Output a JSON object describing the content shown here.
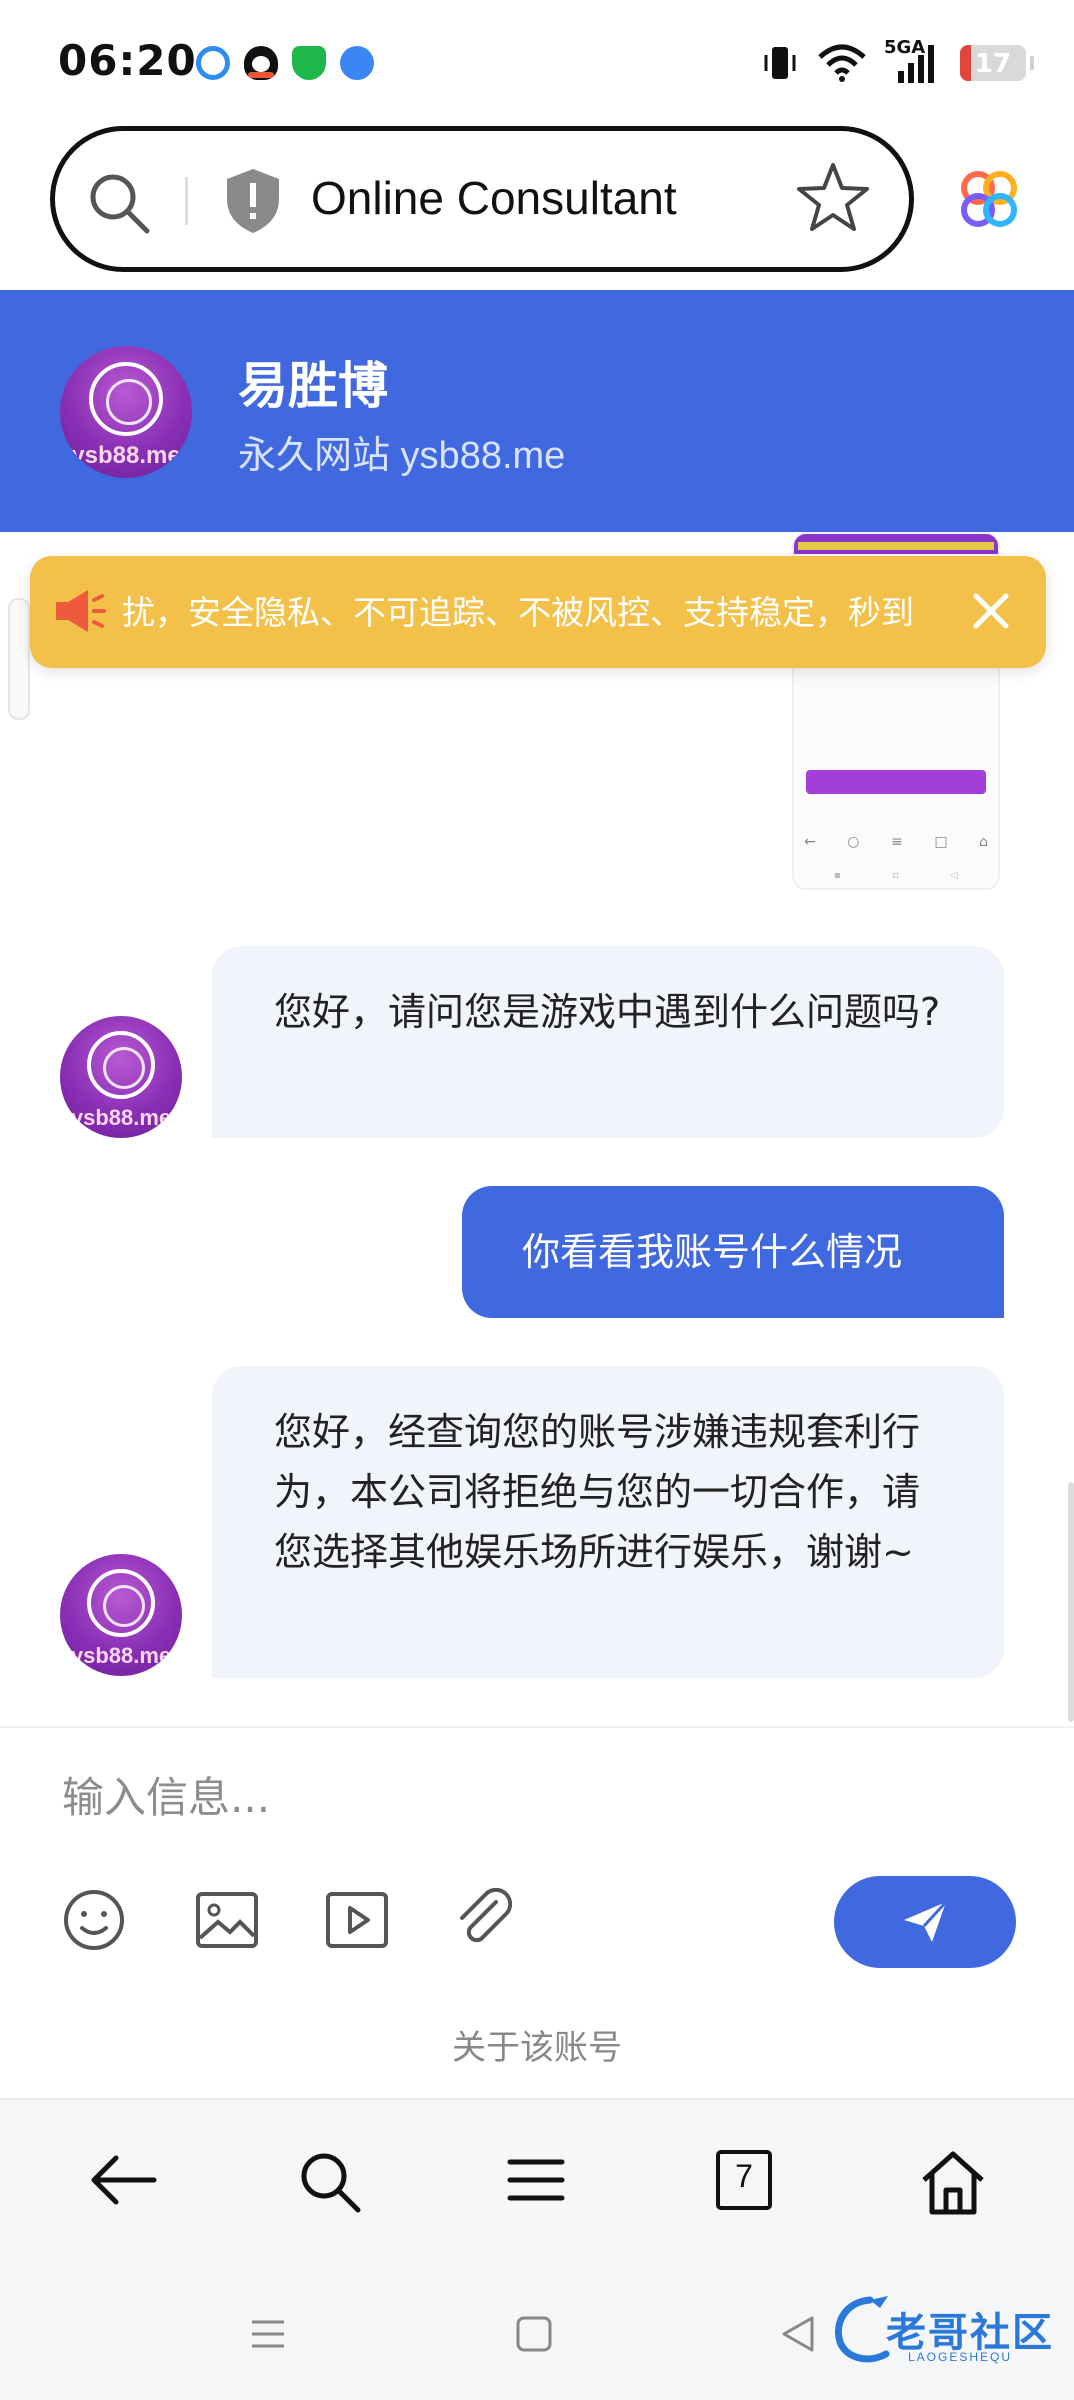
{
  "status_bar": {
    "time": "06:20",
    "network": "5GA",
    "battery": "17",
    "battery_level_percent": 17,
    "notification_icons": [
      "message-app-icon",
      "qq-penguin-icon",
      "security-shield-icon",
      "browser-app-icon"
    ]
  },
  "browser": {
    "address_title": "Online Consultant",
    "tab_count": "7",
    "icons": [
      "search-icon",
      "site-shield-icon",
      "bookmark-star-icon",
      "browser-logo-icon"
    ]
  },
  "chat_header": {
    "name": "易胜博",
    "subtitle": "永久网站 ysb88.me",
    "avatar_text": "ysb88.me"
  },
  "notice": {
    "text": "扰，安全隐私、不可追踪、不被风控、支持稳定，秒到"
  },
  "messages": [
    {
      "side": "left",
      "text": "您好，请问您是游戏中遇到什么问题吗?"
    },
    {
      "side": "right",
      "text": "你看看我账号什么情况"
    },
    {
      "side": "left",
      "text": "您好，经查询您的账号涉嫌违规套利行为，本公司将拒绝与您的一切合作，请您选择其他娱乐场所进行娱乐，谢谢~"
    }
  ],
  "input": {
    "placeholder": "输入信息..."
  },
  "about_account": "关于该账号",
  "watermark": {
    "text": "老哥社区",
    "sub": "LAOGESHEQU"
  },
  "colors": {
    "brand_blue": "#4068df",
    "notice_yellow": "#f3c14a",
    "bubble_left_bg": "#f2f4fc",
    "avatar_purple": "#8a2fb5"
  }
}
